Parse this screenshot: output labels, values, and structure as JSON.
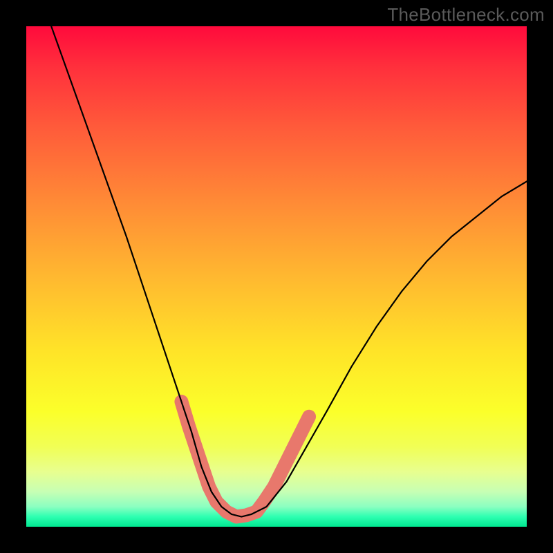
{
  "watermark": "TheBottleneck.com",
  "chart_data": {
    "type": "line",
    "title": "",
    "xlabel": "",
    "ylabel": "",
    "xlim": [
      0,
      100
    ],
    "ylim": [
      0,
      100
    ],
    "series": [
      {
        "name": "curve",
        "x": [
          5,
          10,
          15,
          20,
          25,
          27,
          30,
          33,
          35,
          37,
          39,
          41,
          43,
          45,
          48,
          52,
          56,
          60,
          65,
          70,
          75,
          80,
          85,
          90,
          95,
          100
        ],
        "values": [
          100,
          86,
          72,
          58,
          43,
          37,
          28,
          19,
          12,
          7,
          4,
          2.5,
          2,
          2.5,
          4,
          9,
          16,
          23,
          32,
          40,
          47,
          53,
          58,
          62,
          66,
          69
        ]
      }
    ],
    "highlight": {
      "name": "highlight-band",
      "color": "#e8786c",
      "points": [
        {
          "x": 31,
          "y": 25
        },
        {
          "x": 32.5,
          "y": 20
        },
        {
          "x": 34.5,
          "y": 14
        },
        {
          "x": 36.5,
          "y": 8
        },
        {
          "x": 38,
          "y": 5
        },
        {
          "x": 40,
          "y": 3
        },
        {
          "x": 42,
          "y": 2
        },
        {
          "x": 44,
          "y": 2.3
        },
        {
          "x": 46,
          "y": 3
        },
        {
          "x": 47.5,
          "y": 5
        },
        {
          "x": 49.5,
          "y": 8
        },
        {
          "x": 53,
          "y": 15
        },
        {
          "x": 55,
          "y": 19
        },
        {
          "x": 56.5,
          "y": 22
        }
      ]
    }
  }
}
